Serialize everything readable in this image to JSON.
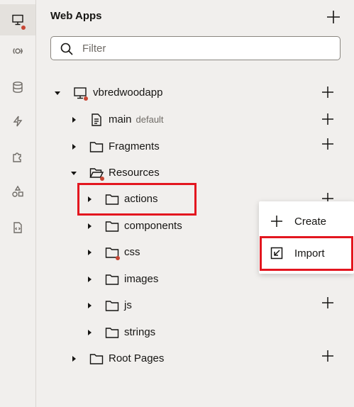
{
  "rail": {
    "items": [
      {
        "icon": "desktop-icon",
        "active": true
      },
      {
        "icon": "service-icon",
        "active": false
      },
      {
        "icon": "database-icon",
        "active": false
      },
      {
        "icon": "lightning-icon",
        "active": false
      },
      {
        "icon": "puzzle-icon",
        "active": false
      },
      {
        "icon": "shapes-icon",
        "active": false
      },
      {
        "icon": "code-file-icon",
        "active": false
      }
    ]
  },
  "panel": {
    "title": "Web Apps",
    "search_placeholder": "Filter"
  },
  "tree": {
    "app": "vbredwoodapp",
    "main": "main",
    "main_sub": "default",
    "fragments": "Fragments",
    "resources": "Resources",
    "actions": "actions",
    "components": "components",
    "css": "css",
    "images": "images",
    "js": "js",
    "strings": "strings",
    "root_pages": "Root Pages"
  },
  "menu": {
    "create": "Create",
    "import": "Import"
  },
  "colors": {
    "accent_red": "#e3161f",
    "status_dot": "#c74634"
  }
}
